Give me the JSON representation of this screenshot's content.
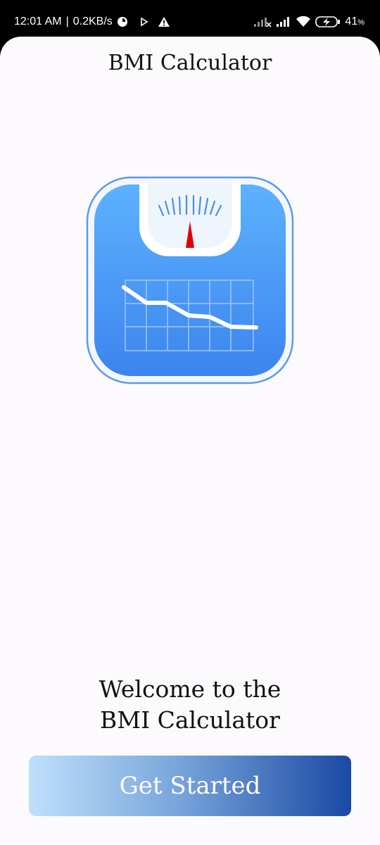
{
  "status_bar": {
    "time": "12:01 AM",
    "net_speed": "0.2KB/s",
    "battery": "41",
    "battery_unit": "%"
  },
  "app": {
    "title": "BMI Calculator"
  },
  "logo": {
    "icon": "bathroom-scale-chart-icon",
    "colors": {
      "blue_top": "#58acff",
      "blue_bottom": "#3c86f0",
      "needle": "#e00000"
    }
  },
  "welcome": {
    "line1": "Welcome to the",
    "line2": "BMI Calculator"
  },
  "button": {
    "label": "Get Started",
    "gradient": [
      "#bfe0fb",
      "#1a49a4"
    ]
  }
}
